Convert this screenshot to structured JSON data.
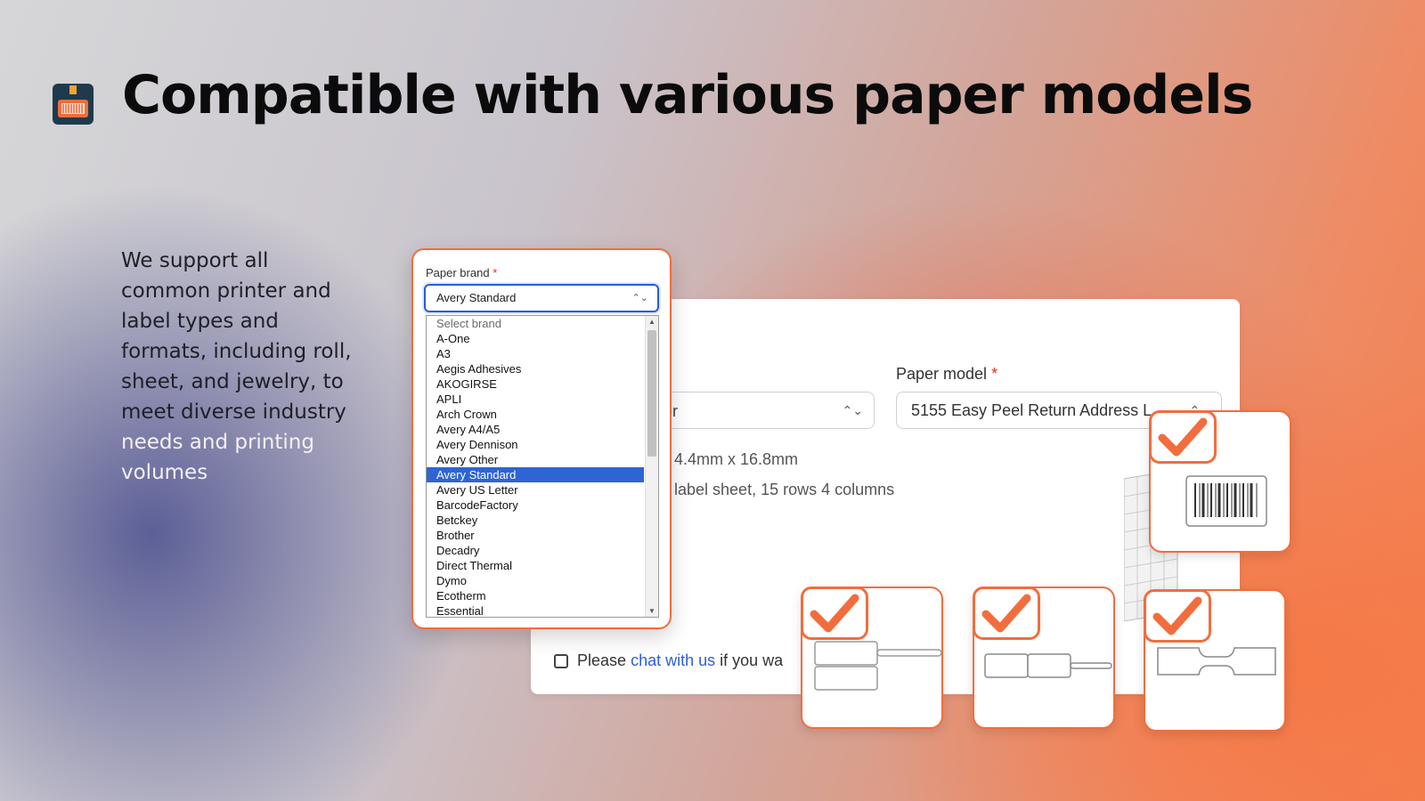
{
  "header": {
    "title": "Compatible with various paper models",
    "icon": "label-printer-icon"
  },
  "description": {
    "text_main": "We support all common printer and label types and formats, including roll, sheet, and jewelry, to meet diverse industry",
    "text_light": "needs and printing volumes"
  },
  "form": {
    "paper_model_label": "Paper model",
    "required_mark": "*",
    "left_select_value": "er",
    "paper_model_value": "5155 Easy Peel Return Address L",
    "label_size": "4.4mm x 16.8mm",
    "sheet_info": "label sheet, 15 rows 4 columns",
    "chat_prefix": "Please",
    "chat_link": "chat with us",
    "chat_suffix": "if you wa"
  },
  "dropdown": {
    "label": "Paper brand",
    "required_mark": "*",
    "selected_value": "Avery Standard",
    "options": [
      "Select brand",
      "A-One",
      "A3",
      "Aegis Adhesives",
      "AKOGIRSE",
      "APLI",
      "Arch Crown",
      "Avery A4/A5",
      "Avery Dennison",
      "Avery Other",
      "Avery Standard",
      "Avery US Letter",
      "BarcodeFactory",
      "Betckey",
      "Brother",
      "Decadry",
      "Direct Thermal",
      "Dymo",
      "Ecotherm",
      "Essential"
    ],
    "selected_index": 10
  },
  "label_types": [
    {
      "name": "barcode-label-card",
      "icon": "checkmark-icon"
    },
    {
      "name": "roll-label-card",
      "icon": "checkmark-icon"
    },
    {
      "name": "jewelry-double-label-card",
      "icon": "checkmark-icon"
    },
    {
      "name": "jewelry-tag-label-card",
      "icon": "checkmark-icon"
    }
  ],
  "colors": {
    "accent": "#f26d3d",
    "select_highlight": "#2e64d4",
    "link": "#2c5ed6"
  }
}
